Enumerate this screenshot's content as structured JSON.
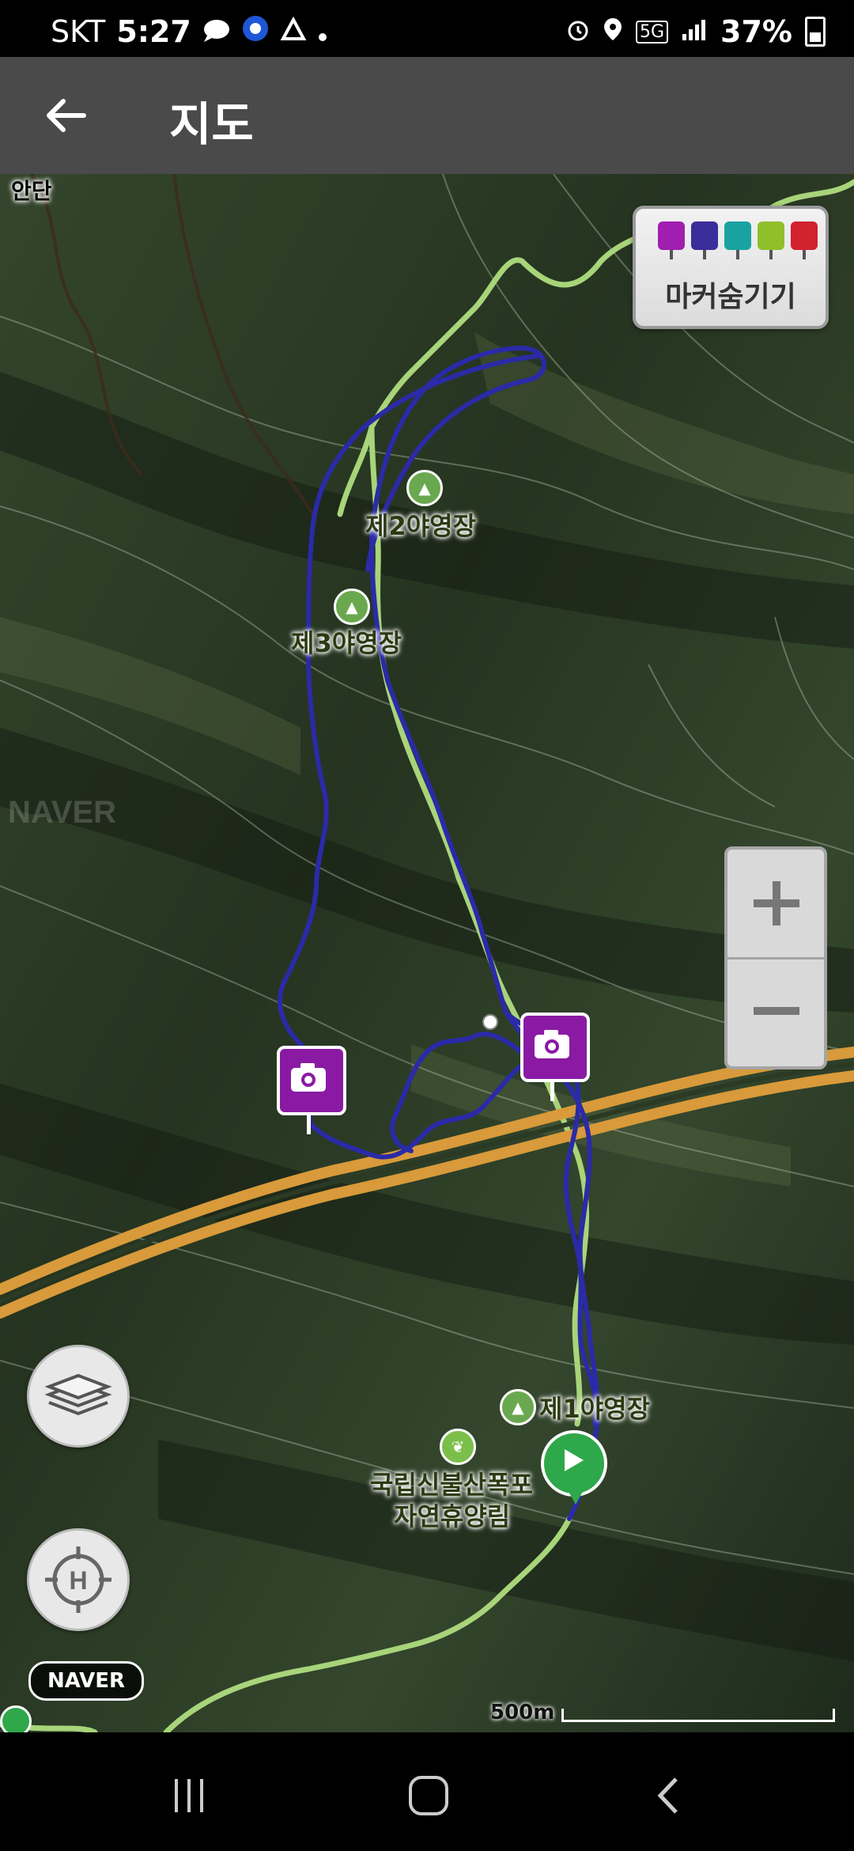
{
  "status_bar": {
    "carrier": "SKT",
    "time": "5:27",
    "network": "5G",
    "battery": "37%"
  },
  "app_bar": {
    "title": "지도"
  },
  "map": {
    "marker_panel": {
      "label": "마커숨기기",
      "icons": [
        {
          "name": "camera-marker-icon",
          "color": "#a01fb0"
        },
        {
          "name": "video-marker-icon",
          "color": "#3a2e9a"
        },
        {
          "name": "voice-marker-icon",
          "color": "#19a3a0"
        },
        {
          "name": "memo-marker-icon",
          "color": "#8fbf2a"
        },
        {
          "name": "flag-marker-icon",
          "color": "#d1222e"
        }
      ]
    },
    "places": {
      "camp2": "제2야영장",
      "camp3": "제3야영장",
      "camp1": "제1야영장",
      "forest_line1": "국립신불산폭포",
      "forest_line2": "자연휴양림"
    },
    "watermark": "NAVER",
    "naver_badge": "NAVER",
    "scale_label": "500m",
    "top_fragment": "안단"
  },
  "colors": {
    "track": "#2b2aa8",
    "road": "#d89a3a",
    "trail": "#9ccf6a",
    "photo_marker": "#8a1aa3",
    "start_marker": "#2ea84a"
  }
}
